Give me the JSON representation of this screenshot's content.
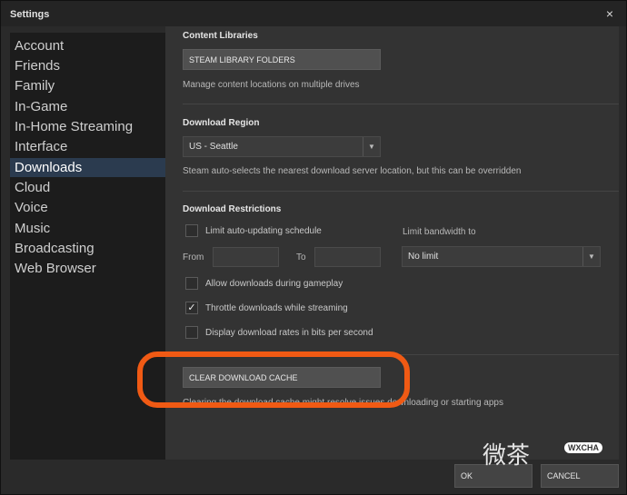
{
  "window": {
    "title": "Settings",
    "close_glyph": "×"
  },
  "sidebar": {
    "items": [
      {
        "label": "Account"
      },
      {
        "label": "Friends"
      },
      {
        "label": "Family"
      },
      {
        "label": "In-Game"
      },
      {
        "label": "In-Home Streaming"
      },
      {
        "label": "Interface"
      },
      {
        "label": "Downloads",
        "selected": true
      },
      {
        "label": "Cloud"
      },
      {
        "label": "Voice"
      },
      {
        "label": "Music"
      },
      {
        "label": "Broadcasting"
      },
      {
        "label": "Web Browser"
      }
    ]
  },
  "content_libraries": {
    "title": "Content Libraries",
    "button": "STEAM LIBRARY FOLDERS",
    "description": "Manage content locations on multiple drives"
  },
  "download_region": {
    "title": "Download Region",
    "selected": "US - Seattle",
    "description": "Steam auto-selects the nearest download server location, but this can be overridden"
  },
  "download_restrictions": {
    "title": "Download Restrictions",
    "limit_auto_update": {
      "label": "Limit auto-updating schedule",
      "checked": false
    },
    "from_label": "From",
    "from_value": "",
    "to_label": "To",
    "to_value": "",
    "bandwidth_label": "Limit bandwidth to",
    "bandwidth_selected": "No limit",
    "allow_during_gameplay": {
      "label": "Allow downloads during gameplay",
      "checked": false
    },
    "throttle_streaming": {
      "label": "Throttle downloads while streaming",
      "checked": true
    },
    "display_bits": {
      "label": "Display download rates in bits per second",
      "checked": false
    }
  },
  "cache": {
    "button": "CLEAR DOWNLOAD CACHE",
    "description": "Clearing the download cache might resolve issues downloading or starting apps"
  },
  "footer": {
    "ok": "OK",
    "cancel": "CANCEL"
  },
  "watermark": {
    "text": "微茶",
    "badge": "WXCHA"
  },
  "colors": {
    "highlight": "#f05a14",
    "selected_bg": "#2b3b4f"
  }
}
